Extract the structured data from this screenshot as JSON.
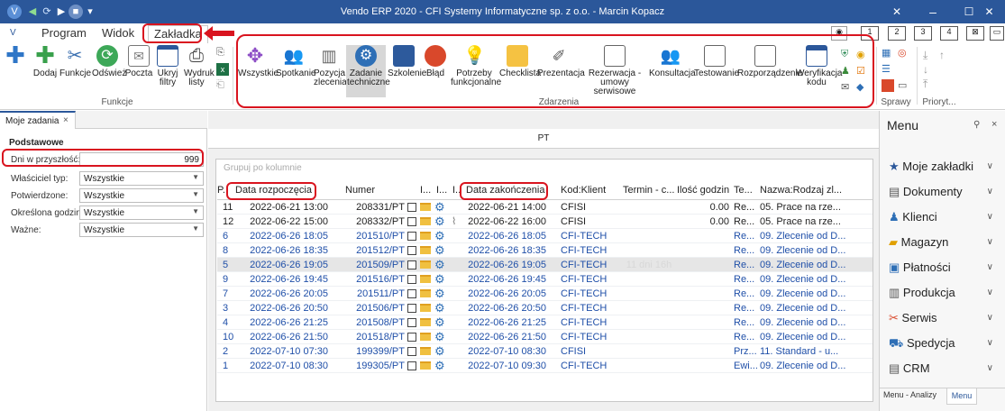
{
  "titlebar": {
    "title": "Vendo ERP 2020 - CFI Systemy Informatyczne sp. z o.o. - Marcin Kopacz"
  },
  "ribbon_tabs": [
    "Program",
    "Widok",
    "Zakładka"
  ],
  "ribbon": {
    "funkcje": {
      "buttons": [
        "Dodaj",
        "Funkcje",
        "Odśwież",
        "Poczta",
        "Ukryj filtry",
        "Wydruk listy"
      ],
      "group_label": "Funkcje"
    },
    "zdarzenia": {
      "buttons": [
        "Wszystkie",
        "Spotkanie",
        "Pozycja zlecenia",
        "Zadanie techniczne",
        "Szkolenie",
        "Błąd",
        "Potrzeby funkcjonalne",
        "Checklista",
        "Prezentacja",
        "Rezerwacja - umowy serwisowe",
        "Konsultacja",
        "Testowanie",
        "Rozporządzenie",
        "Weryfikacja kodu"
      ],
      "group_label": "Zdarzenia"
    },
    "sprawy_label": "Sprawy",
    "priorytet_label": "Prioryt..."
  },
  "layout_numbers": [
    "1",
    "2",
    "3",
    "4"
  ],
  "left": {
    "tab": "Moje zadania",
    "section": "Podstawowe",
    "days": {
      "label": "Dni w przyszłość:",
      "value": "999"
    },
    "filters": [
      {
        "label": "Właściciel typ:",
        "value": "Wszystkie"
      },
      {
        "label": "Potwierdzone:",
        "value": "Wszystkie"
      },
      {
        "label": "Określona godzina:",
        "value": "Wszystkie"
      },
      {
        "label": "Ważne:",
        "value": "Wszystkie"
      }
    ]
  },
  "main": {
    "header": "PT",
    "group_hint": "Grupuj po kolumnie",
    "columns": [
      "P..",
      "Data rozpoczęcia",
      "Numer",
      "I...",
      "I...",
      "I...",
      "Data zakończenia",
      "Kod:Klient",
      "Termin - c...",
      "Ilość godzin",
      "Te...",
      "Nazwa:Rodzaj zl..."
    ],
    "rows": [
      {
        "p": "11",
        "start": "2022-06-21 13:00",
        "num": "208331/PT",
        "end": "2022-06-21 14:00",
        "client": "CFISI",
        "termin": "",
        "hours": "0.00",
        "te": "Re...",
        "name": "05. Prace na rze...",
        "color": "#222222",
        "clip": false
      },
      {
        "p": "12",
        "start": "2022-06-22 15:00",
        "num": "208332/PT",
        "end": "2022-06-22 16:00",
        "client": "CFISI",
        "termin": "",
        "hours": "0.00",
        "te": "Re...",
        "name": "05. Prace na rze...",
        "color": "#222222",
        "clip": true
      },
      {
        "p": "6",
        "start": "2022-06-26 18:05",
        "num": "201510/PT",
        "end": "2022-06-26 18:05",
        "client": "CFI-TECH",
        "termin": "",
        "hours": "",
        "te": "Re...",
        "name": "09. Zlecenie od D...",
        "color": "#1f4fa8",
        "clip": false
      },
      {
        "p": "8",
        "start": "2022-06-26 18:35",
        "num": "201512/PT",
        "end": "2022-06-26 18:35",
        "client": "CFI-TECH",
        "termin": "",
        "hours": "",
        "te": "Re...",
        "name": "09. Zlecenie od D...",
        "color": "#1f4fa8",
        "clip": false
      },
      {
        "p": "5",
        "start": "2022-06-26 19:05",
        "num": "201509/PT",
        "end": "2022-06-26 19:05",
        "client": "CFI-TECH",
        "termin": "11 dni 16h",
        "hours": "",
        "te": "Re...",
        "name": "09. Zlecenie od D...",
        "color": "#1f4fa8",
        "clip": false,
        "selected": true
      },
      {
        "p": "9",
        "start": "2022-06-26 19:45",
        "num": "201516/PT",
        "end": "2022-06-26 19:45",
        "client": "CFI-TECH",
        "termin": "",
        "hours": "",
        "te": "Re...",
        "name": "09. Zlecenie od D...",
        "color": "#1f4fa8",
        "clip": false
      },
      {
        "p": "7",
        "start": "2022-06-26 20:05",
        "num": "201511/PT",
        "end": "2022-06-26 20:05",
        "client": "CFI-TECH",
        "termin": "",
        "hours": "",
        "te": "Re...",
        "name": "09. Zlecenie od D...",
        "color": "#1f4fa8",
        "clip": false
      },
      {
        "p": "3",
        "start": "2022-06-26 20:50",
        "num": "201506/PT",
        "end": "2022-06-26 20:50",
        "client": "CFI-TECH",
        "termin": "",
        "hours": "",
        "te": "Re...",
        "name": "09. Zlecenie od D...",
        "color": "#1f4fa8",
        "clip": false
      },
      {
        "p": "4",
        "start": "2022-06-26 21:25",
        "num": "201508/PT",
        "end": "2022-06-26 21:25",
        "client": "CFI-TECH",
        "termin": "",
        "hours": "",
        "te": "Re...",
        "name": "09. Zlecenie od D...",
        "color": "#1f4fa8",
        "clip": false
      },
      {
        "p": "10",
        "start": "2022-06-26 21:50",
        "num": "201518/PT",
        "end": "2022-06-26 21:50",
        "client": "CFI-TECH",
        "termin": "",
        "hours": "",
        "te": "Re...",
        "name": "09. Zlecenie od D...",
        "color": "#1f4fa8",
        "clip": false
      },
      {
        "p": "2",
        "start": "2022-07-10 07:30",
        "num": "199399/PT",
        "end": "2022-07-10 08:30",
        "client": "CFISI",
        "termin": "",
        "hours": "",
        "te": "Prz...",
        "name": "11. Standard - u...",
        "color": "#1f4fa8",
        "clip": false
      },
      {
        "p": "1",
        "start": "2022-07-10 08:30",
        "num": "199305/PT",
        "end": "2022-07-10 09:30",
        "client": "CFI-TECH",
        "termin": "",
        "hours": "",
        "te": "Ewi...",
        "name": "09. Zlecenie od D...",
        "color": "#1f4fa8",
        "clip": false
      }
    ]
  },
  "right": {
    "title": "Menu",
    "items": [
      "Moje zakładki",
      "Dokumenty",
      "Klienci",
      "Magazyn",
      "Płatności",
      "Produkcja",
      "Serwis",
      "Spedycja",
      "CRM"
    ],
    "bottom_tabs": [
      "Menu - Analizy",
      "Menu"
    ]
  },
  "colors": {
    "title_bar": "#2b579a",
    "accent_red": "#d9141f",
    "row_blue": "#1f4fa8",
    "selection": "#e6e6e6"
  }
}
